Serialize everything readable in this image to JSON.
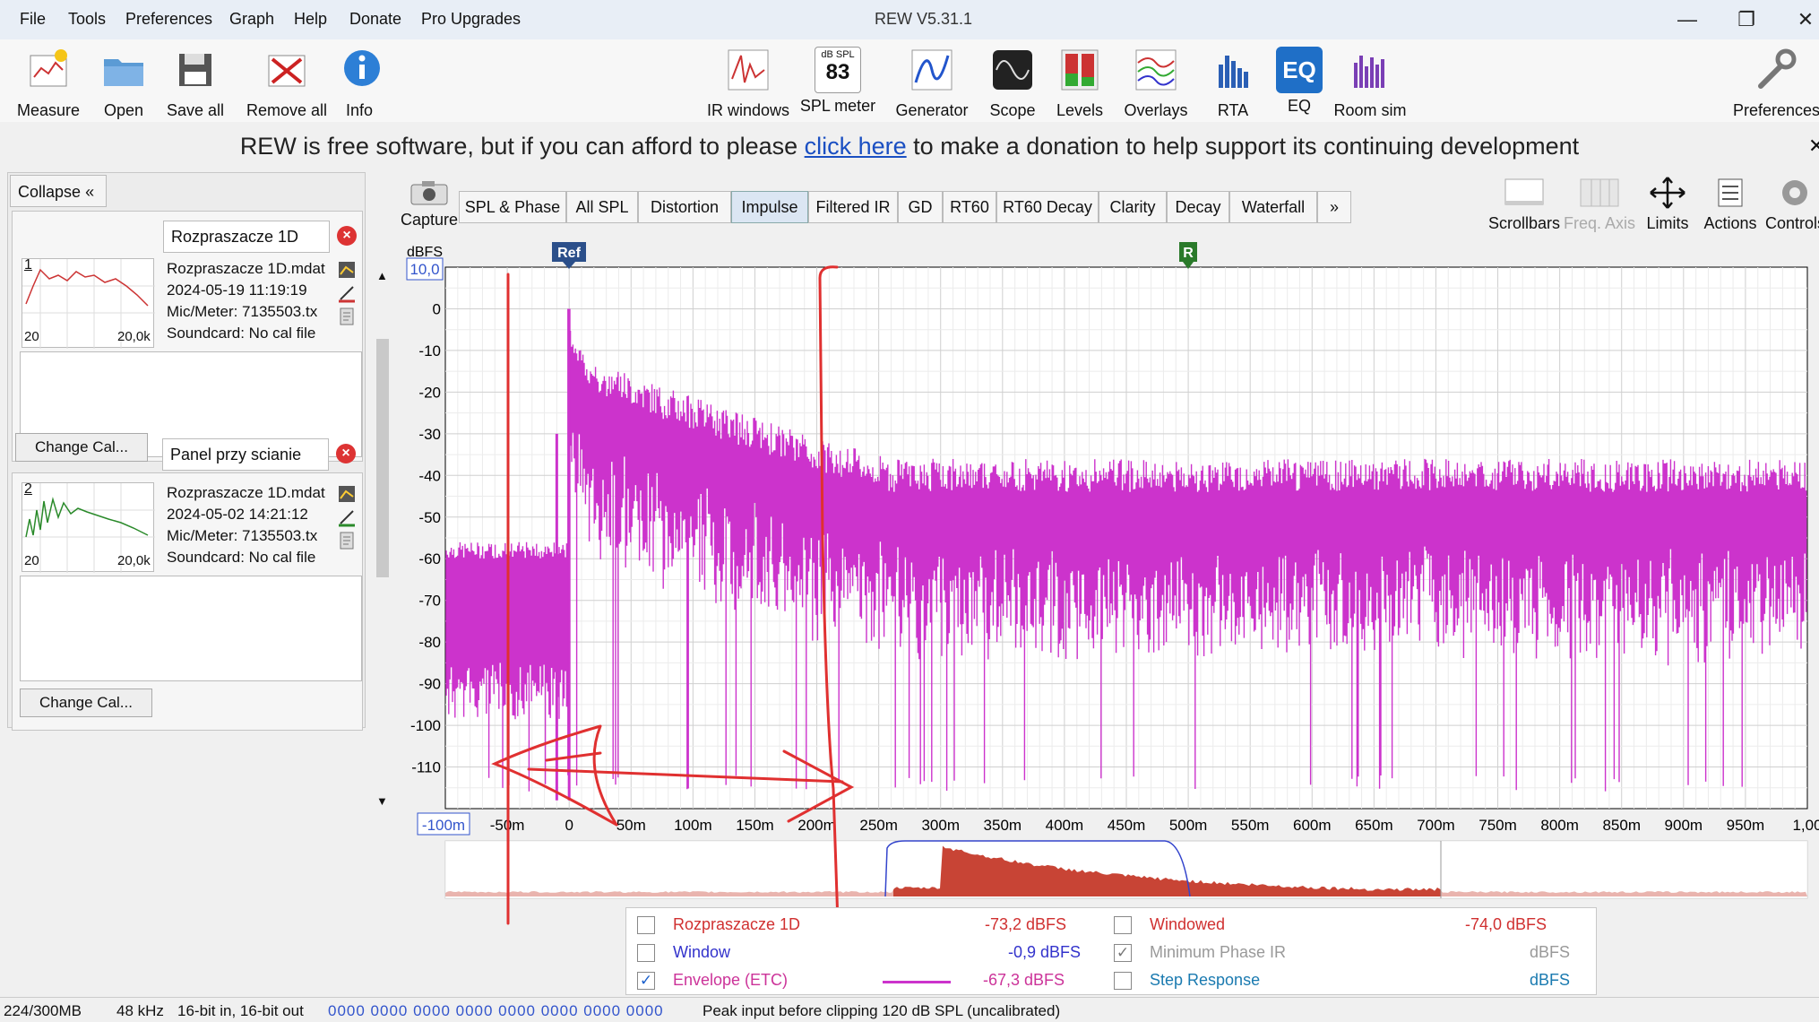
{
  "menu": [
    "File",
    "Tools",
    "Preferences",
    "Graph",
    "Help",
    "Donate",
    "Pro Upgrades"
  ],
  "app_title": "REW V5.31.1",
  "toolbar_left": [
    "Measure",
    "Open",
    "Save all",
    "Remove all",
    "Info"
  ],
  "toolbar_center": [
    "IR windows",
    "SPL meter",
    "Generator",
    "Scope",
    "Levels",
    "Overlays",
    "RTA",
    "EQ",
    "Room sim"
  ],
  "spl_meter_badge": {
    "top": "dB SPL",
    "value": "83"
  },
  "toolbar_right": "Preferences",
  "banner": {
    "before": "REW is free software, but if you can afford to please ",
    "link": "click here",
    "after": " to make a donation to help support its continuing development"
  },
  "left_panel": {
    "collapse": "Collapse",
    "measurements": [
      {
        "index": "1",
        "name": "Rozpraszacze 1D",
        "file": "Rozpraszacze 1D.mdat",
        "date": "2024-05-19 11:19:19",
        "mic": "Mic/Meter: 7135503.tx",
        "soundcard": "Soundcard: No cal file",
        "thumb_min": "20",
        "thumb_max": "20,0k",
        "thumb_color": "#cc3333"
      },
      {
        "index": "2",
        "name": "Panel przy scianie",
        "file": "Rozpraszacze 1D.mdat",
        "date": "2024-05-02 14:21:12",
        "mic": "Mic/Meter: 7135503.tx",
        "soundcard": "Soundcard: No cal file",
        "thumb_min": "20",
        "thumb_max": "20,0k",
        "thumb_color": "#2a8a2a"
      }
    ],
    "change_cal": "Change Cal..."
  },
  "capture": "Capture",
  "tabs": [
    "SPL & Phase",
    "All SPL",
    "Distortion",
    "Impulse",
    "Filtered IR",
    "GD",
    "RT60",
    "RT60 Decay",
    "Clarity",
    "Decay",
    "Waterfall",
    "»"
  ],
  "active_tab": "Impulse",
  "right_tools": [
    "Scrollbars",
    "Freq. Axis",
    "Limits",
    "Actions",
    "Controls"
  ],
  "graph": {
    "y_unit": "dBFS",
    "y_top_box": "10,0",
    "y_ticks": [
      "0",
      "-10",
      "-20",
      "-30",
      "-40",
      "-50",
      "-60",
      "-70",
      "-80",
      "-90",
      "-100",
      "-110"
    ],
    "x_left_box": "-100m",
    "x_ticks": [
      "-50m",
      "0",
      "50m",
      "100m",
      "150m",
      "200m",
      "250m",
      "300m",
      "350m",
      "400m",
      "450m",
      "500m",
      "550m",
      "600m",
      "650m",
      "700m",
      "750m",
      "800m",
      "850m",
      "900m",
      "950m",
      "1,00"
    ],
    "ref_marker": "Ref",
    "r_marker": "R",
    "trace_color": "#cc33cc",
    "annotation_color": "#e03030"
  },
  "legend": [
    {
      "label": "Rozpraszacze 1D",
      "value": "-73,2 dBFS",
      "checked": false,
      "color": "#d03030"
    },
    {
      "label": "Window",
      "value": "-0,9 dBFS",
      "checked": false,
      "color": "#3333cc"
    },
    {
      "label": "Envelope (ETC)",
      "value": "-67,3 dBFS",
      "checked": true,
      "color": "#cc3399"
    },
    {
      "label": "Windowed",
      "value": "-74,0 dBFS",
      "checked": false,
      "color": "#d03030"
    },
    {
      "label": "Minimum Phase IR",
      "value": "dBFS",
      "checked": true,
      "color": "#999999"
    },
    {
      "label": "Step Response",
      "value": "dBFS",
      "checked": false,
      "color": "#1a7ab0"
    }
  ],
  "status": [
    "224/300MB",
    "48 kHz",
    "16-bit in, 16-bit out",
    "0000 0000  0000 0000  0000 0000  0000 0000",
    "Peak input before clipping 120 dB SPL (uncalibrated)"
  ]
}
